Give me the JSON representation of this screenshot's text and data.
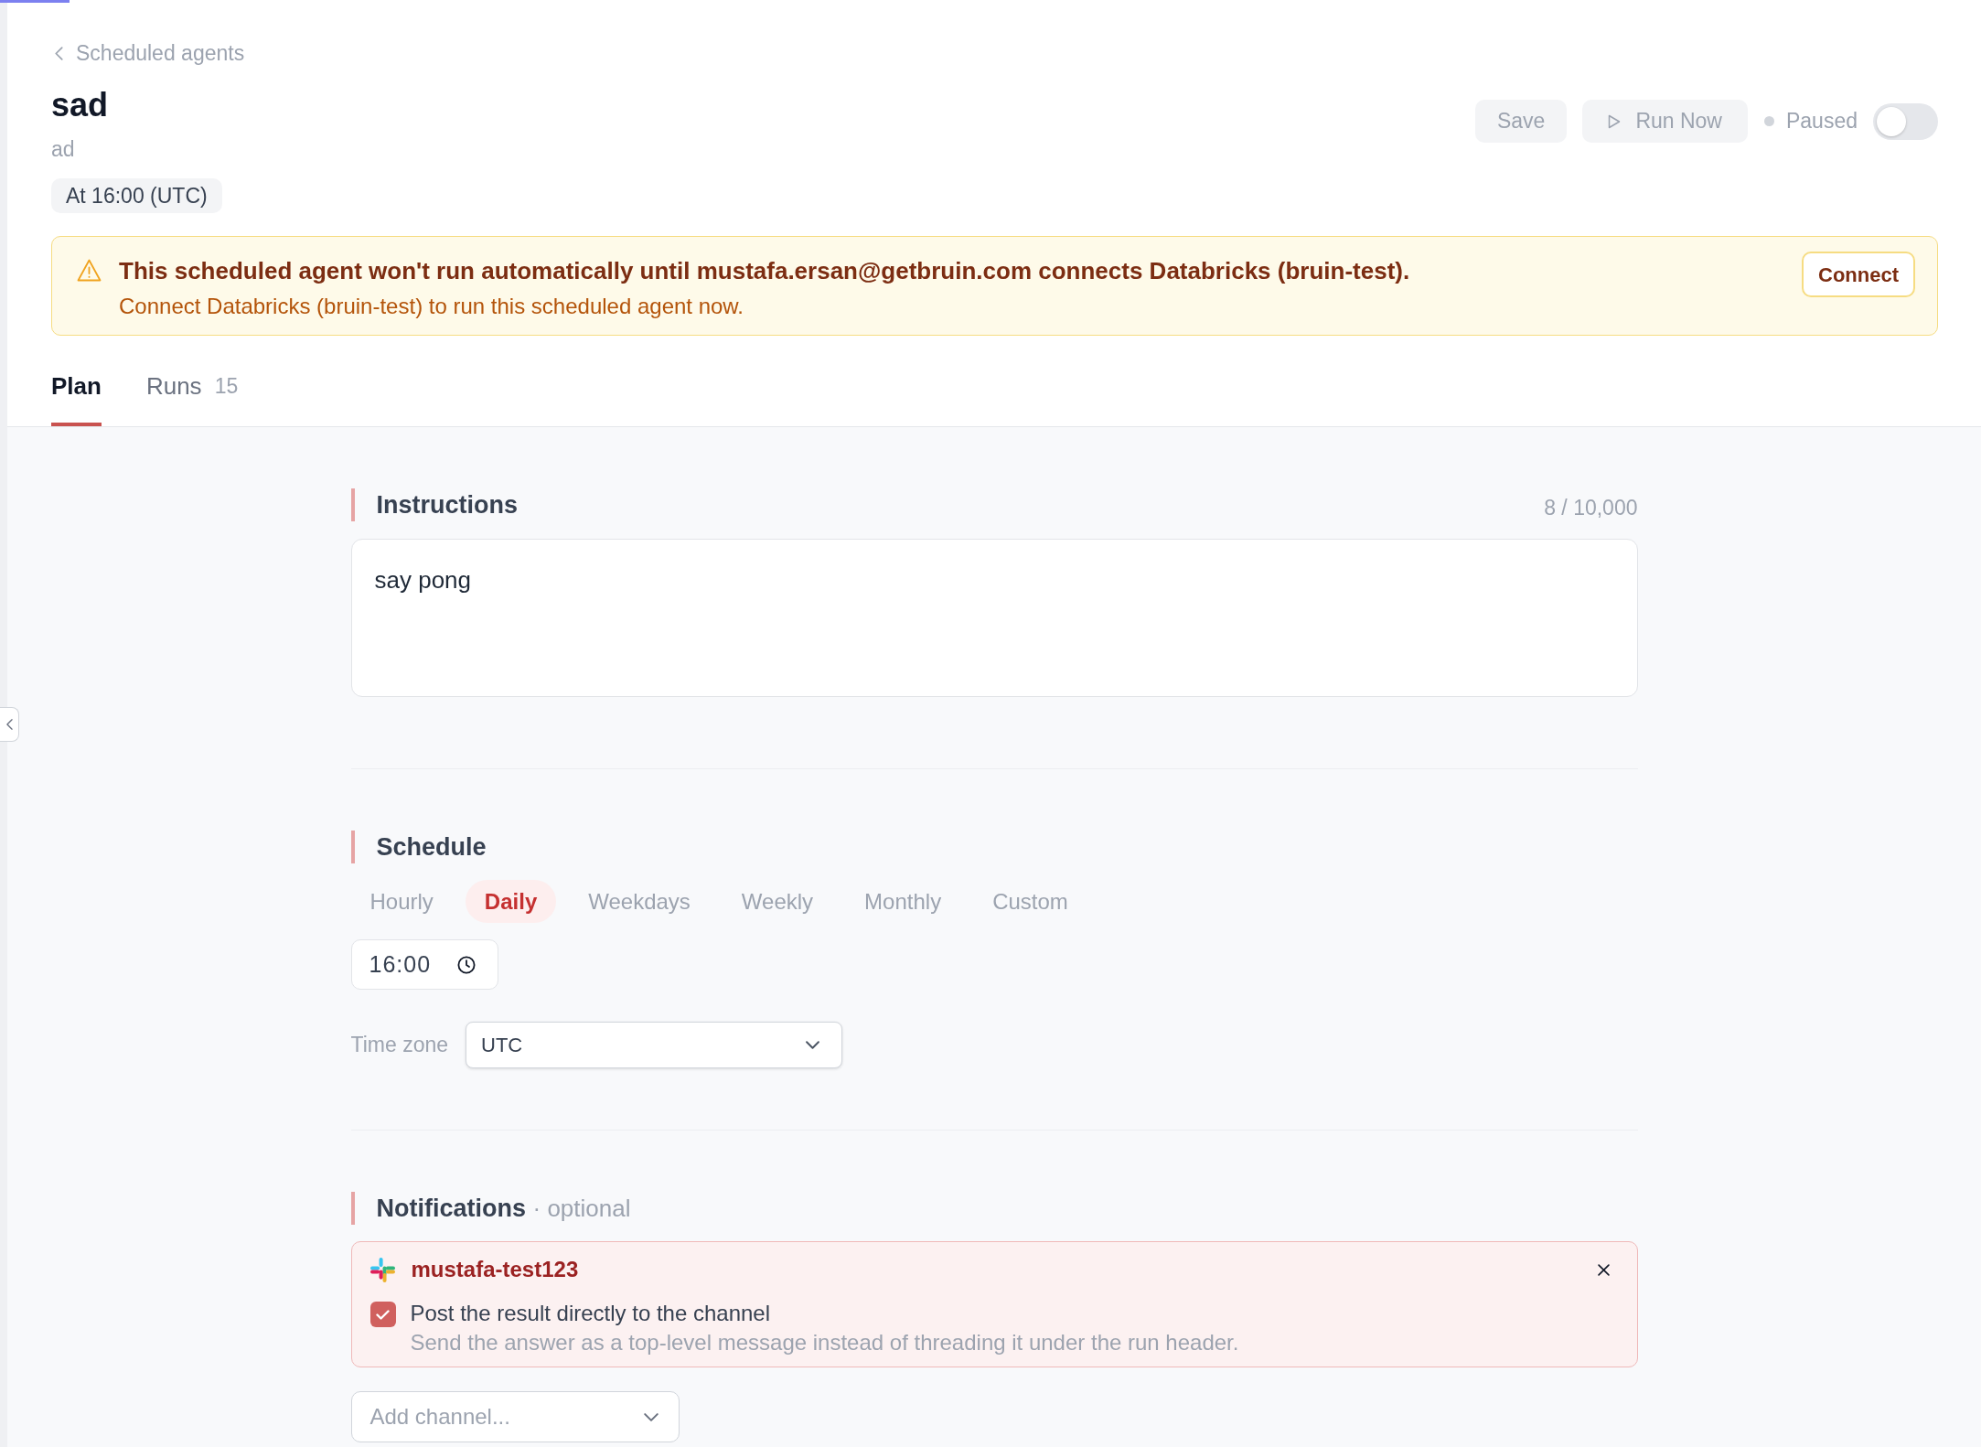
{
  "page_progress": {
    "level": 0.035
  },
  "breadcrumb": {
    "label": "Scheduled agents"
  },
  "agent": {
    "title": "sad",
    "description": "ad",
    "schedule_badge": "At 16:00 (UTC)"
  },
  "actions": {
    "save": {
      "label": "Save",
      "disabled": true
    },
    "run_now": {
      "label": "Run Now",
      "disabled": true
    },
    "status": {
      "label": "Paused",
      "on": false
    }
  },
  "banner": {
    "title": "This scheduled agent won't run automatically until mustafa.ersan@getbruin.com connects Databricks (bruin-test).",
    "message": "Connect Databricks (bruin-test) to run this scheduled agent now.",
    "button": "Connect"
  },
  "tabs": [
    {
      "label": "Plan",
      "selected": true
    },
    {
      "label": "Runs",
      "count": "15",
      "selected": false
    }
  ],
  "instructions": {
    "heading": "Instructions",
    "counter": "8 / 10,000",
    "value": "say pong"
  },
  "schedule": {
    "heading": "Schedule",
    "options": [
      {
        "label": "Hourly",
        "selected": false
      },
      {
        "label": "Daily",
        "selected": true
      },
      {
        "label": "Weekdays",
        "selected": false
      },
      {
        "label": "Weekly",
        "selected": false
      },
      {
        "label": "Monthly",
        "selected": false
      },
      {
        "label": "Custom",
        "selected": false
      }
    ],
    "time": "16:00",
    "timezone_label": "Time zone",
    "timezone": "UTC"
  },
  "notifications": {
    "heading": "Notifications",
    "hint": "· optional",
    "channels": [
      {
        "name": "mustafa-test123",
        "post_to_channel": {
          "label": "Post the result directly to the channel",
          "description": "Send the answer as a top-level message instead of threading it under the run header.",
          "checked": true
        }
      }
    ],
    "add_channel": {
      "placeholder": "Add channel..."
    }
  }
}
